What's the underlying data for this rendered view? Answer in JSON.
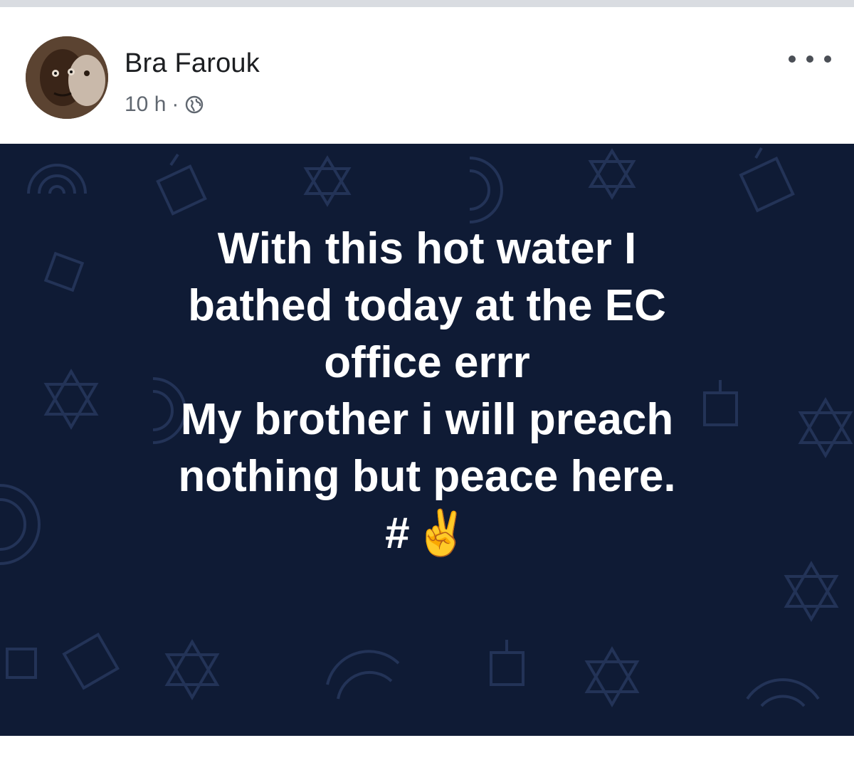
{
  "post": {
    "author": "Bra Farouk",
    "time": "10 h",
    "separator": "·",
    "privacy_icon": "globe-icon",
    "more_icon": "more-options-icon",
    "background_color": "#0f1b35",
    "text_lines": [
      "With this hot water I",
      "bathed today at the EC",
      "office errr",
      "My brother i will preach",
      "nothing but peace here."
    ],
    "hashtag": "#",
    "emoji": "✌️"
  }
}
